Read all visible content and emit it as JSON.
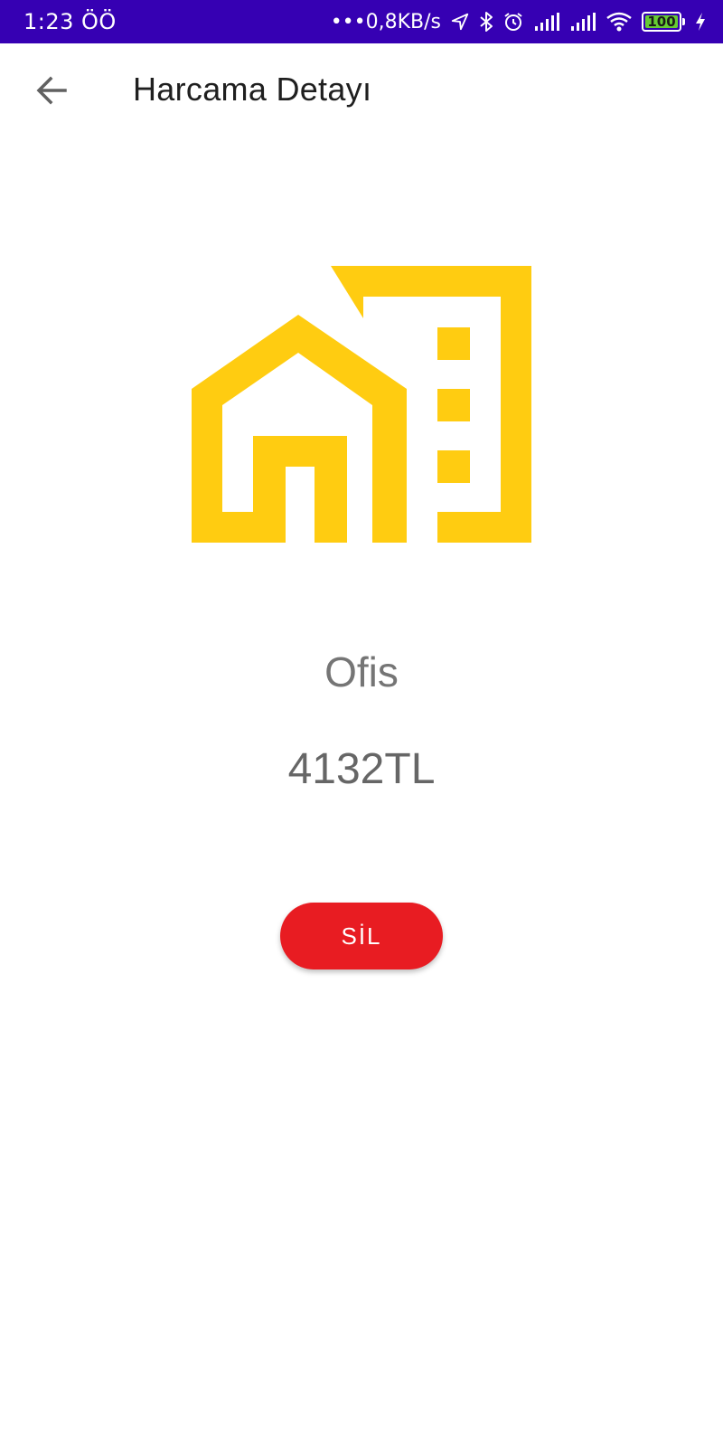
{
  "status_bar": {
    "time": "1:23 ÖÖ",
    "network_speed": "•••0,8KB/s",
    "battery_level": "100",
    "icons": [
      "location-icon",
      "bluetooth-icon",
      "alarm-icon",
      "signal-icon",
      "signal-icon",
      "wifi-icon",
      "battery-icon",
      "charging-icon"
    ]
  },
  "header": {
    "back_icon": "arrow-left-icon",
    "title": "Harcama Detayı"
  },
  "expense": {
    "icon": "home-building-icon",
    "icon_color": "#ffcc11",
    "category": "Ofis",
    "amount": "4132TL"
  },
  "actions": {
    "delete_label": "SİL",
    "delete_color": "#e81c22"
  },
  "colors": {
    "status_bar": "#3600b3",
    "background": "#ffffff"
  }
}
